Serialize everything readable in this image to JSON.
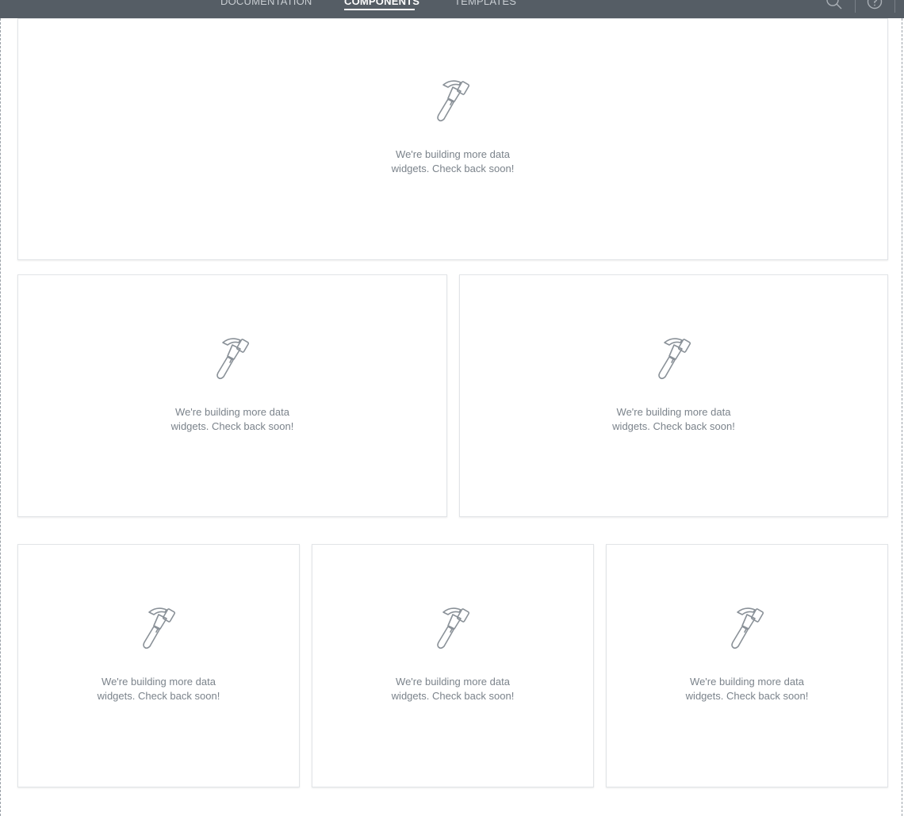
{
  "nav": {
    "items": [
      {
        "label": "DOCUMENTATION",
        "active": false
      },
      {
        "label": "COMPONENTS",
        "active": true
      },
      {
        "label": "TEMPLATES",
        "active": false
      }
    ],
    "icons": [
      "search-icon",
      "help-icon"
    ]
  },
  "colors": {
    "topbar": "#555d65",
    "message_text": "#7b838b",
    "icon_stroke": "#8a9198"
  },
  "cards": [
    {
      "icon": "hammer-icon",
      "message": "We're building more data widgets. Check back soon!"
    },
    {
      "icon": "hammer-icon",
      "message": "We're building more data widgets. Check back soon!"
    },
    {
      "icon": "hammer-icon",
      "message": "We're building more data widgets. Check back soon!"
    },
    {
      "icon": "hammer-icon",
      "message": "We're building more data widgets. Check back soon!"
    },
    {
      "icon": "hammer-icon",
      "message": "We're building more data widgets. Check back soon!"
    },
    {
      "icon": "hammer-icon",
      "message": "We're building more data widgets. Check back soon!"
    }
  ]
}
